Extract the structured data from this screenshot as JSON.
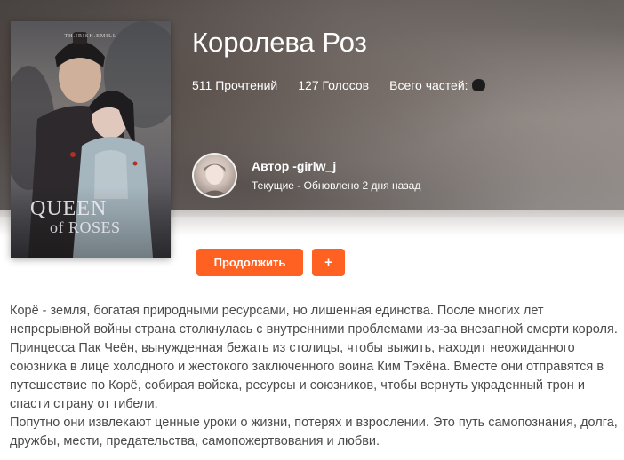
{
  "story": {
    "title": "Королева Роз",
    "cover_brand": "TH.IRISH.EMILL",
    "cover_title_line1": "QUEEN",
    "cover_title_line2": "of ROSES"
  },
  "stats": {
    "reads": "511 Прочтений",
    "votes": "127 Голосов",
    "parts_label": "Всего частей:"
  },
  "author": {
    "name": "Автор -girlw_j",
    "status": "Текущие - Обновлено 2 дня назад"
  },
  "actions": {
    "continue_label": "Продолжить",
    "add_label": "+"
  },
  "description": {
    "paragraph1": "Корё - земля, богатая природными ресурсами, но лишенная единства. После многих лет непрерывной войны страна столкнулась с внутренними проблемами из-за внезапной смерти короля. Принцесса Пак Чеён, вынужденная бежать из столицы, чтобы выжить, находит неожиданного союзника в лице холодного и жестокого заключенного воина Ким Тэхёна. Вместе они отправятся в путешествие по Корё, собирая войска, ресурсы и союзников, чтобы вернуть украденный трон и спасти страну от гибели.",
    "paragraph2": "Попутно они извлекают ценные уроки о жизни, потерях и взрослении. Это путь самопознания, долга, дружбы, мести, предательства, самопожертвования и любви."
  },
  "colors": {
    "accent": "#ff6122",
    "text": "#4b4b4b"
  }
}
